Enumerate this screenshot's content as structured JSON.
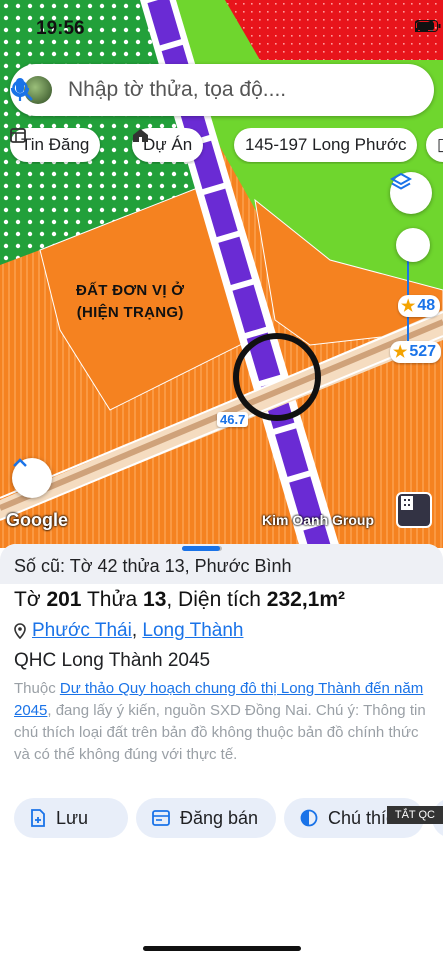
{
  "status_bar": {
    "time": "19:56"
  },
  "search": {
    "placeholder": "Nhập tờ thửa, tọa độ...."
  },
  "chips": [
    {
      "label": "Tin Đăng",
      "icon": "listing-icon"
    },
    {
      "label": "Dự Án",
      "icon": "building-icon"
    },
    {
      "label": "145-197 Long Phước",
      "icon": ""
    }
  ],
  "map": {
    "zone_label_line1": "ĐẤT ĐƠN VỊ Ở",
    "zone_label_line2": "(HIỆN TRẠNG)",
    "badge_1": "48",
    "badge_2": "527",
    "road_label": "46.7",
    "google_label": "Google",
    "brand_label": "Kim Oanh Group",
    "colors": {
      "orange": "#f58220",
      "green": "#6fd62e",
      "red": "#e8141b",
      "purple": "#6a2bd4"
    }
  },
  "sheet": {
    "old_ref": "Số cũ: Tờ 42 thửa 13, Phước Bình",
    "title_prefix_1": "Tờ ",
    "sheet_no": "201",
    "title_mid": " Thửa ",
    "parcel_no": "13",
    "title_mid2": ", Diện tích ",
    "area": "232,1m²",
    "location_1": "Phước Thái",
    "location_sep": ", ",
    "location_2": "Long Thành",
    "plan_name": "QHC Long Thành 2045",
    "desc_prefix": "Thuộc ",
    "desc_link": "Dư thảo Quy hoạch chung đô thị Long Thành đến năm 2045",
    "desc_suffix": ", đang lấy ý kiến, nguồn SXD Đồng Nai. Chú ý: Thông tin chú thích loại đất trên bản đồ không thuộc bản đồ chính thức và có thể không đúng với thực tế.",
    "actions": [
      {
        "label": "Lưu",
        "icon": "save-icon"
      },
      {
        "label": "Đăng bán",
        "icon": "post-icon"
      },
      {
        "label": "Chú thích",
        "icon": "legend-icon"
      }
    ],
    "ad_toggle": "TẮT QC"
  }
}
